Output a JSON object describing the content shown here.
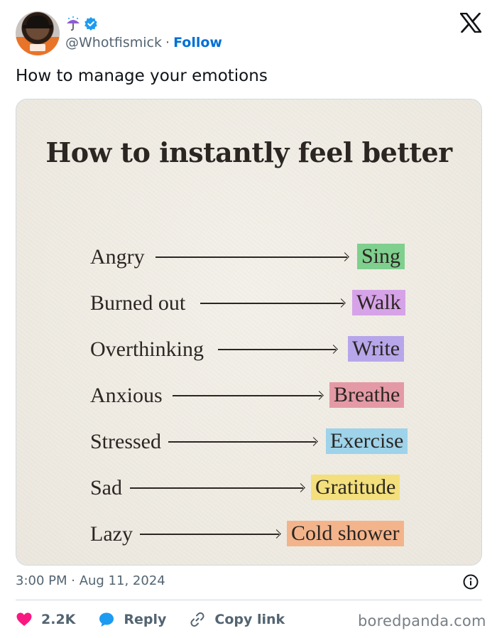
{
  "author": {
    "emoji": "☔",
    "handle": "@Whotfismick",
    "separator": "·",
    "follow_label": "Follow"
  },
  "tweet": {
    "text": "How to manage your emotions",
    "timestamp": "3:00 PM · Aug 11, 2024"
  },
  "image": {
    "title": "How to instantly feel better",
    "rows": [
      {
        "emotion": "Angry",
        "action": "Sing",
        "color": "#7fcf8e"
      },
      {
        "emotion": "Burned out",
        "action": "Walk",
        "color": "#d6a3e8"
      },
      {
        "emotion": "Overthinking",
        "action": "Write",
        "color": "#b8a6ea"
      },
      {
        "emotion": "Anxious",
        "action": "Breathe",
        "color": "#e49aa6"
      },
      {
        "emotion": "Stressed",
        "action": "Exercise",
        "color": "#9ed3ea"
      },
      {
        "emotion": "Sad",
        "action": "Gratitude",
        "color": "#f3e07c"
      },
      {
        "emotion": "Lazy",
        "action": "Cold shower",
        "color": "#f3b48c"
      }
    ]
  },
  "actions": {
    "likes": "2.2K",
    "reply_label": "Reply",
    "copy_label": "Copy link"
  },
  "watermark": "boredpanda.com",
  "colors": {
    "follow": "#006fd6",
    "secondary_text": "#536471",
    "like": "#f91880",
    "reply": "#1d9bf0",
    "verified": "#1d9bf0"
  }
}
